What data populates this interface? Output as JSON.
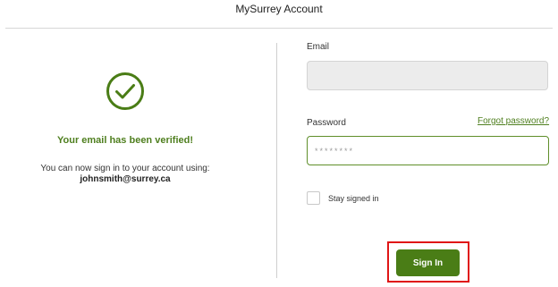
{
  "header": {
    "title": "MySurrey Account"
  },
  "verification": {
    "icon": "check-circle-icon",
    "heading": "Your email has been verified!",
    "info": "You can now sign in to your account using:",
    "email": "johnsmith@surrey.ca"
  },
  "form": {
    "email_label": "Email",
    "email_value": "",
    "password_label": "Password",
    "password_value": "********",
    "forgot_label": "Forgot password?",
    "stay_signed_in_label": "Stay signed in",
    "stay_signed_in_checked": false,
    "signin_label": "Sign In"
  },
  "colors": {
    "accent_green": "#4a7d16",
    "highlight_red": "#e01616"
  }
}
